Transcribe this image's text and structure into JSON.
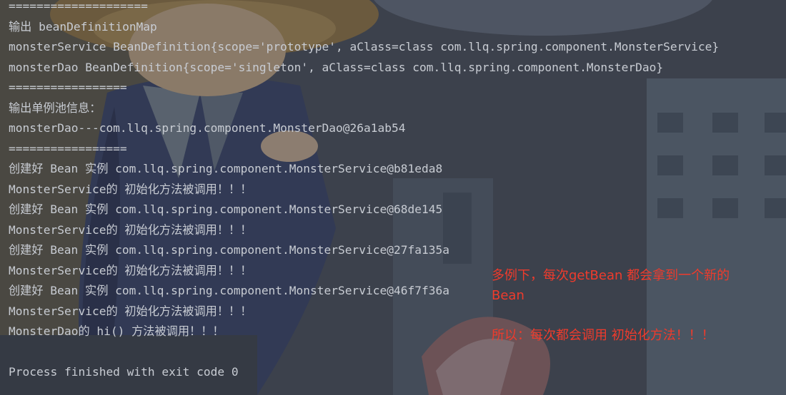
{
  "console": {
    "lines": [
      "====================",
      "输出 beanDefinitionMap",
      "monsterService BeanDefinition{scope='prototype', aClass=class com.llq.spring.component.MonsterService}",
      "monsterDao BeanDefinition{scope='singleton', aClass=class com.llq.spring.component.MonsterDao}",
      "=================",
      "输出单例池信息：",
      "monsterDao---com.llq.spring.component.MonsterDao@26a1ab54",
      "=================",
      "创建好 Bean 实例 com.llq.spring.component.MonsterService@b81eda8",
      "MonsterService的 初始化方法被调用！！！",
      "创建好 Bean 实例 com.llq.spring.component.MonsterService@68de145",
      "MonsterService的 初始化方法被调用！！！",
      "创建好 Bean 实例 com.llq.spring.component.MonsterService@27fa135a",
      "MonsterService的 初始化方法被调用！！！",
      "创建好 Bean 实例 com.llq.spring.component.MonsterService@46f7f36a",
      "MonsterService的 初始化方法被调用！！！",
      "MonsterDao的 hi() 方法被调用！！！",
      "",
      "Process finished with exit code 0"
    ]
  },
  "annotation": {
    "line1": "多例下，每次getBean 都会拿到一个新的",
    "line2": "Bean",
    "line3": "",
    "line4": "所以：每次都会调用 初始化方法！！！"
  },
  "colors": {
    "console_text": "#c8ccd3",
    "annotation_text": "#ef3b2c",
    "background_base": "#3a3f4b"
  },
  "icons": {
    "background": "anime-illustration-watermark"
  }
}
